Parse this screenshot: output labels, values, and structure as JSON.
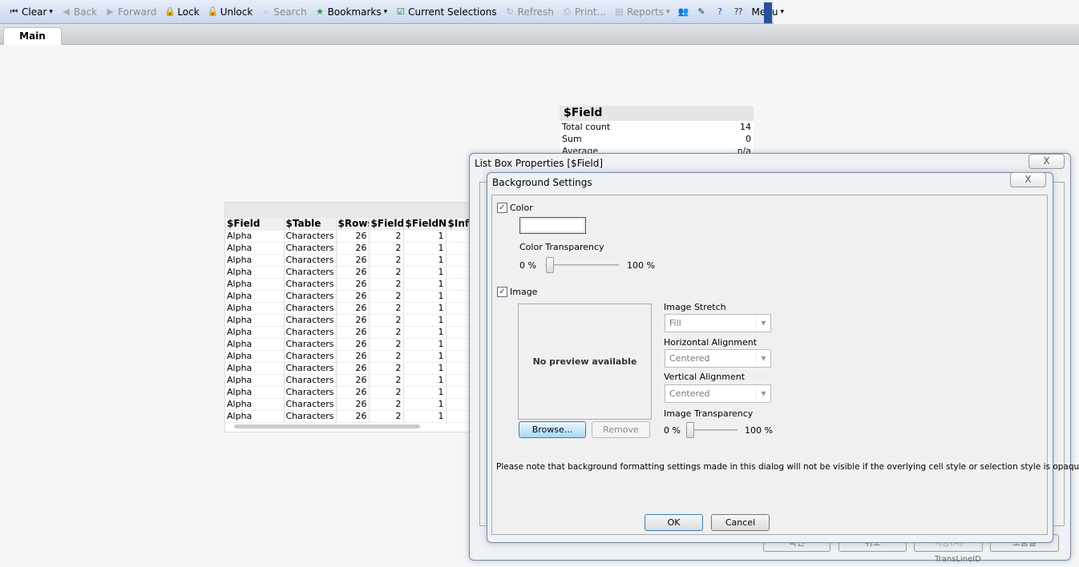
{
  "toolbar": {
    "items": [
      {
        "label": "Clear",
        "icon": "clear-icon",
        "enabled": true,
        "dropdown": true
      },
      {
        "label": "Back",
        "icon": "back-icon",
        "enabled": false
      },
      {
        "label": "Forward",
        "icon": "forward-icon",
        "enabled": false
      },
      {
        "label": "Lock",
        "icon": "lock-icon",
        "enabled": true
      },
      {
        "label": "Unlock",
        "icon": "unlock-icon",
        "enabled": true
      },
      {
        "label": "Search",
        "icon": "search-icon",
        "enabled": false
      },
      {
        "label": "Bookmarks",
        "icon": "star-icon",
        "enabled": true,
        "dropdown": true
      },
      {
        "label": "Current Selections",
        "icon": "checkbox-icon",
        "enabled": true
      },
      {
        "label": "Refresh",
        "icon": "refresh-icon",
        "enabled": false
      },
      {
        "label": "Print...",
        "icon": "print-icon",
        "enabled": false
      },
      {
        "label": "Reports",
        "icon": "reports-icon",
        "enabled": false,
        "dropdown": true
      },
      {
        "label": "",
        "icon": "users-icon",
        "enabled": true
      },
      {
        "label": "",
        "icon": "edit-icon",
        "enabled": true
      },
      {
        "label": "",
        "icon": "help-icon",
        "enabled": true
      },
      {
        "label": "",
        "icon": "context-help-icon",
        "enabled": true
      },
      {
        "label": "Menu",
        "icon": "",
        "enabled": true,
        "dropdown": true
      }
    ]
  },
  "tabs": [
    {
      "label": "Main",
      "active": true
    }
  ],
  "statbox": {
    "title": "$Field",
    "rows": [
      {
        "k": "Total count",
        "v": "14"
      },
      {
        "k": "Sum",
        "v": "0"
      },
      {
        "k": "Average",
        "v": "n/a"
      }
    ]
  },
  "table": {
    "columns": [
      "$Field",
      "$Table",
      "$Rows",
      "$Fields",
      "$FieldNo",
      "$Info"
    ],
    "rows": [
      [
        "Alpha",
        "Characters",
        "26",
        "2",
        "1",
        ""
      ],
      [
        "Alpha",
        "Characters",
        "26",
        "2",
        "1",
        ""
      ],
      [
        "Alpha",
        "Characters",
        "26",
        "2",
        "1",
        ""
      ],
      [
        "Alpha",
        "Characters",
        "26",
        "2",
        "1",
        ""
      ],
      [
        "Alpha",
        "Characters",
        "26",
        "2",
        "1",
        ""
      ],
      [
        "Alpha",
        "Characters",
        "26",
        "2",
        "1",
        ""
      ],
      [
        "Alpha",
        "Characters",
        "26",
        "2",
        "1",
        ""
      ],
      [
        "Alpha",
        "Characters",
        "26",
        "2",
        "1",
        ""
      ],
      [
        "Alpha",
        "Characters",
        "26",
        "2",
        "1",
        ""
      ],
      [
        "Alpha",
        "Characters",
        "26",
        "2",
        "1",
        ""
      ],
      [
        "Alpha",
        "Characters",
        "26",
        "2",
        "1",
        ""
      ],
      [
        "Alpha",
        "Characters",
        "26",
        "2",
        "1",
        ""
      ],
      [
        "Alpha",
        "Characters",
        "26",
        "2",
        "1",
        ""
      ],
      [
        "Alpha",
        "Characters",
        "26",
        "2",
        "1",
        ""
      ],
      [
        "Alpha",
        "Characters",
        "26",
        "2",
        "1",
        ""
      ],
      [
        "Alpha",
        "Characters",
        "26",
        "2",
        "1",
        ""
      ]
    ]
  },
  "outer_dialog": {
    "title": "List Box Properties [$Field]",
    "close": "X",
    "buttons": [
      "확인",
      "취소",
      "적용(A)",
      "도움말"
    ],
    "behind_text": "TransLineID"
  },
  "inner_dialog": {
    "title": "Background Settings",
    "close": "X",
    "color": {
      "label": "Color",
      "checked": true,
      "transparency_label": "Color Transparency",
      "min": "0 %",
      "max": "100 %",
      "transparency_value": 0
    },
    "image": {
      "label": "Image",
      "checked": true,
      "preview": "No preview available",
      "browse": "Browse...",
      "remove": "Remove",
      "stretch_label": "Image Stretch",
      "stretch_value": "Fill",
      "halign_label": "Horizontal Alignment",
      "halign_value": "Centered",
      "valign_label": "Vertical Alignment",
      "valign_value": "Centered",
      "transparency_label": "Image Transparency",
      "min": "0 %",
      "max": "100 %",
      "transparency_value": 0
    },
    "note": "Please note that background formatting settings made in this dialog will not be visible if the overlying cell style or selection style is opaque",
    "ok": "OK",
    "cancel": "Cancel"
  }
}
